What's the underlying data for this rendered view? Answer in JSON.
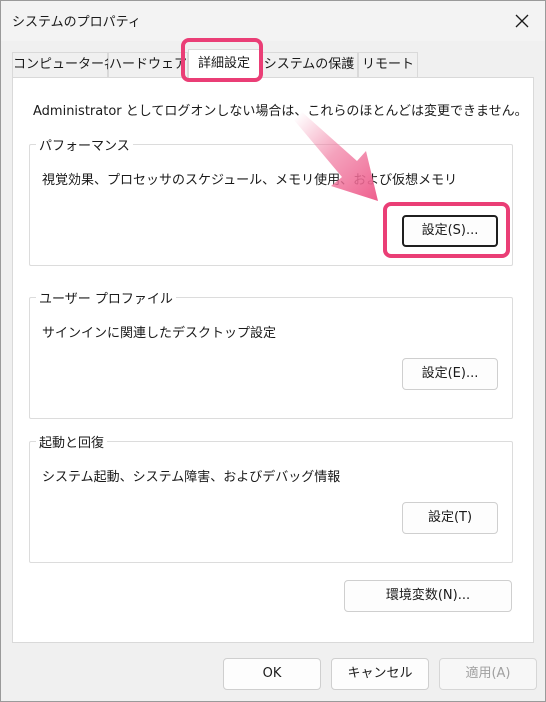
{
  "window": {
    "title": "システムのプロパティ"
  },
  "tabs": [
    {
      "label": "コンピューター名"
    },
    {
      "label": "ハードウェア"
    },
    {
      "label": "詳細設定"
    },
    {
      "label": "システムの保護"
    },
    {
      "label": "リモート"
    }
  ],
  "intro": "Administrator としてログオンしない場合は、これらのほとんどは変更できません。",
  "performance": {
    "title": "パフォーマンス",
    "description": "視覚効果、プロセッサのスケジュール、メモリ使用、および仮想メモリ",
    "button": "設定(S)..."
  },
  "user_profile": {
    "title": "ユーザー プロファイル",
    "description": "サインインに関連したデスクトップ設定",
    "button": "設定(E)..."
  },
  "startup": {
    "title": "起動と回復",
    "description": "システム起動、システム障害、およびデバッグ情報",
    "button": "設定(T)"
  },
  "env_button": "環境変数(N)...",
  "footer": {
    "ok": "OK",
    "cancel": "キャンセル",
    "apply": "適用(A)"
  },
  "colors": {
    "highlight": "#ea3e76",
    "arrow": "#f07aa0"
  },
  "icons": {
    "close": "close-icon"
  }
}
